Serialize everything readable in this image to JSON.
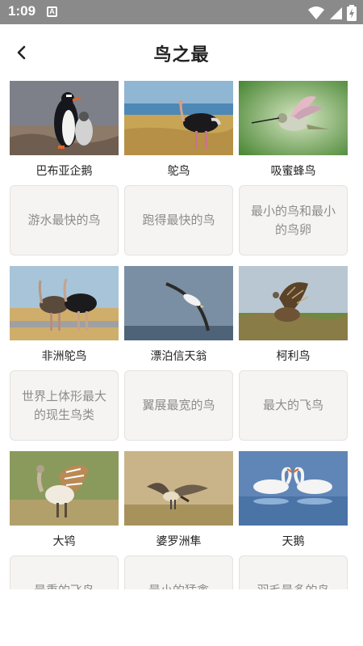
{
  "status_bar": {
    "time": "1:09",
    "notification_badge": "A",
    "icons": [
      "wifi-icon",
      "signal-icon",
      "battery-charging-icon"
    ]
  },
  "header": {
    "title": "鸟之最",
    "back_icon": "chevron-left-icon"
  },
  "colors": {
    "status_bar": "#8a8a8a",
    "card_background": "#f5f4f2",
    "card_text": "#8c8c8c",
    "title_text": "#222222"
  },
  "birds": [
    {
      "name": "巴布亚企鹅",
      "fact": "游水最快的鸟",
      "image_icon": "penguin-photo"
    },
    {
      "name": "鸵鸟",
      "fact": "跑得最快的鸟",
      "image_icon": "ostrich-photo"
    },
    {
      "name": "吸蜜蜂鸟",
      "fact": "最小的鸟和最小的鸟卵",
      "image_icon": "hummingbird-photo"
    },
    {
      "name": "非洲鸵鸟",
      "fact": "世界上体形最大的现生鸟类",
      "image_icon": "african-ostrich-photo"
    },
    {
      "name": "漂泊信天翁",
      "fact": "翼展最宽的鸟",
      "image_icon": "albatross-photo"
    },
    {
      "name": "柯利鸟",
      "fact": "最大的飞鸟",
      "image_icon": "kori-bustard-photo"
    },
    {
      "name": "大鸨",
      "fact": "最重的飞鸟",
      "image_icon": "great-bustard-photo"
    },
    {
      "name": "婆罗洲隼",
      "fact": "最小的猛禽",
      "image_icon": "falconet-photo"
    },
    {
      "name": "天鹅",
      "fact": "羽毛最多的鸟",
      "image_icon": "swan-photo"
    }
  ]
}
